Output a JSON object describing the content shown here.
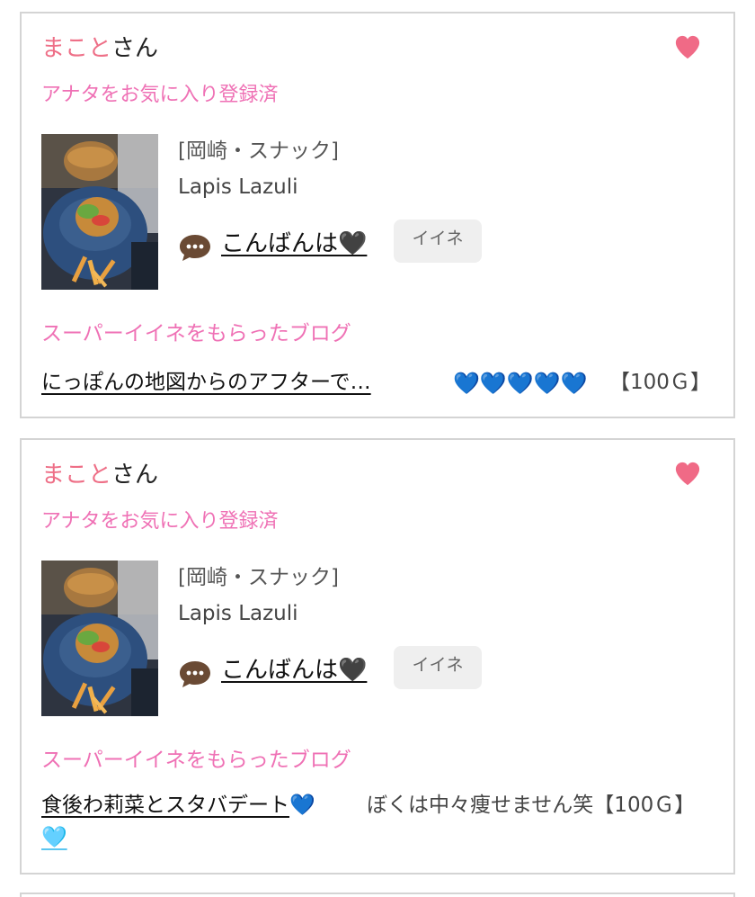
{
  "posts": [
    {
      "user_name": "まこと",
      "honorific": "さん",
      "fav_status": "アナタをお気に入り登録済",
      "shop_category": "[岡崎・スナック]",
      "shop_name": "Lapis Lazuli",
      "comment": "こんばんは🖤",
      "iine_label": "イイネ",
      "super_label": "スーパーイイネをもらったブログ",
      "blog_title": "にっぽんの地図からのアフターで…",
      "blog_hearts": "💙💙💙💙💙",
      "reward": "【100Ｇ】"
    },
    {
      "user_name": "まこと",
      "honorific": "さん",
      "fav_status": "アナタをお気に入り登録済",
      "shop_category": "[岡崎・スナック]",
      "shop_name": "Lapis Lazuli",
      "comment": "こんばんは🖤",
      "iine_label": "イイネ",
      "super_label": "スーパーイイネをもらったブログ",
      "blog_title": "食後わ莉菜とスタバデート",
      "blog_title_emoji_1": "💙",
      "blog_title_emoji_2": "🩵",
      "blog_desc": "ぼくは中々痩せません笑【100Ｇ】"
    }
  ],
  "icons": {
    "favorite": "heart-icon",
    "comment": "speech-bubble-icon"
  },
  "colors": {
    "name_pink": "#ee6f87",
    "label_pink": "#ef71b5",
    "heart_pink": "#f06a86",
    "blue_heart": "#2a86f0",
    "border": "#d4d4d4"
  }
}
